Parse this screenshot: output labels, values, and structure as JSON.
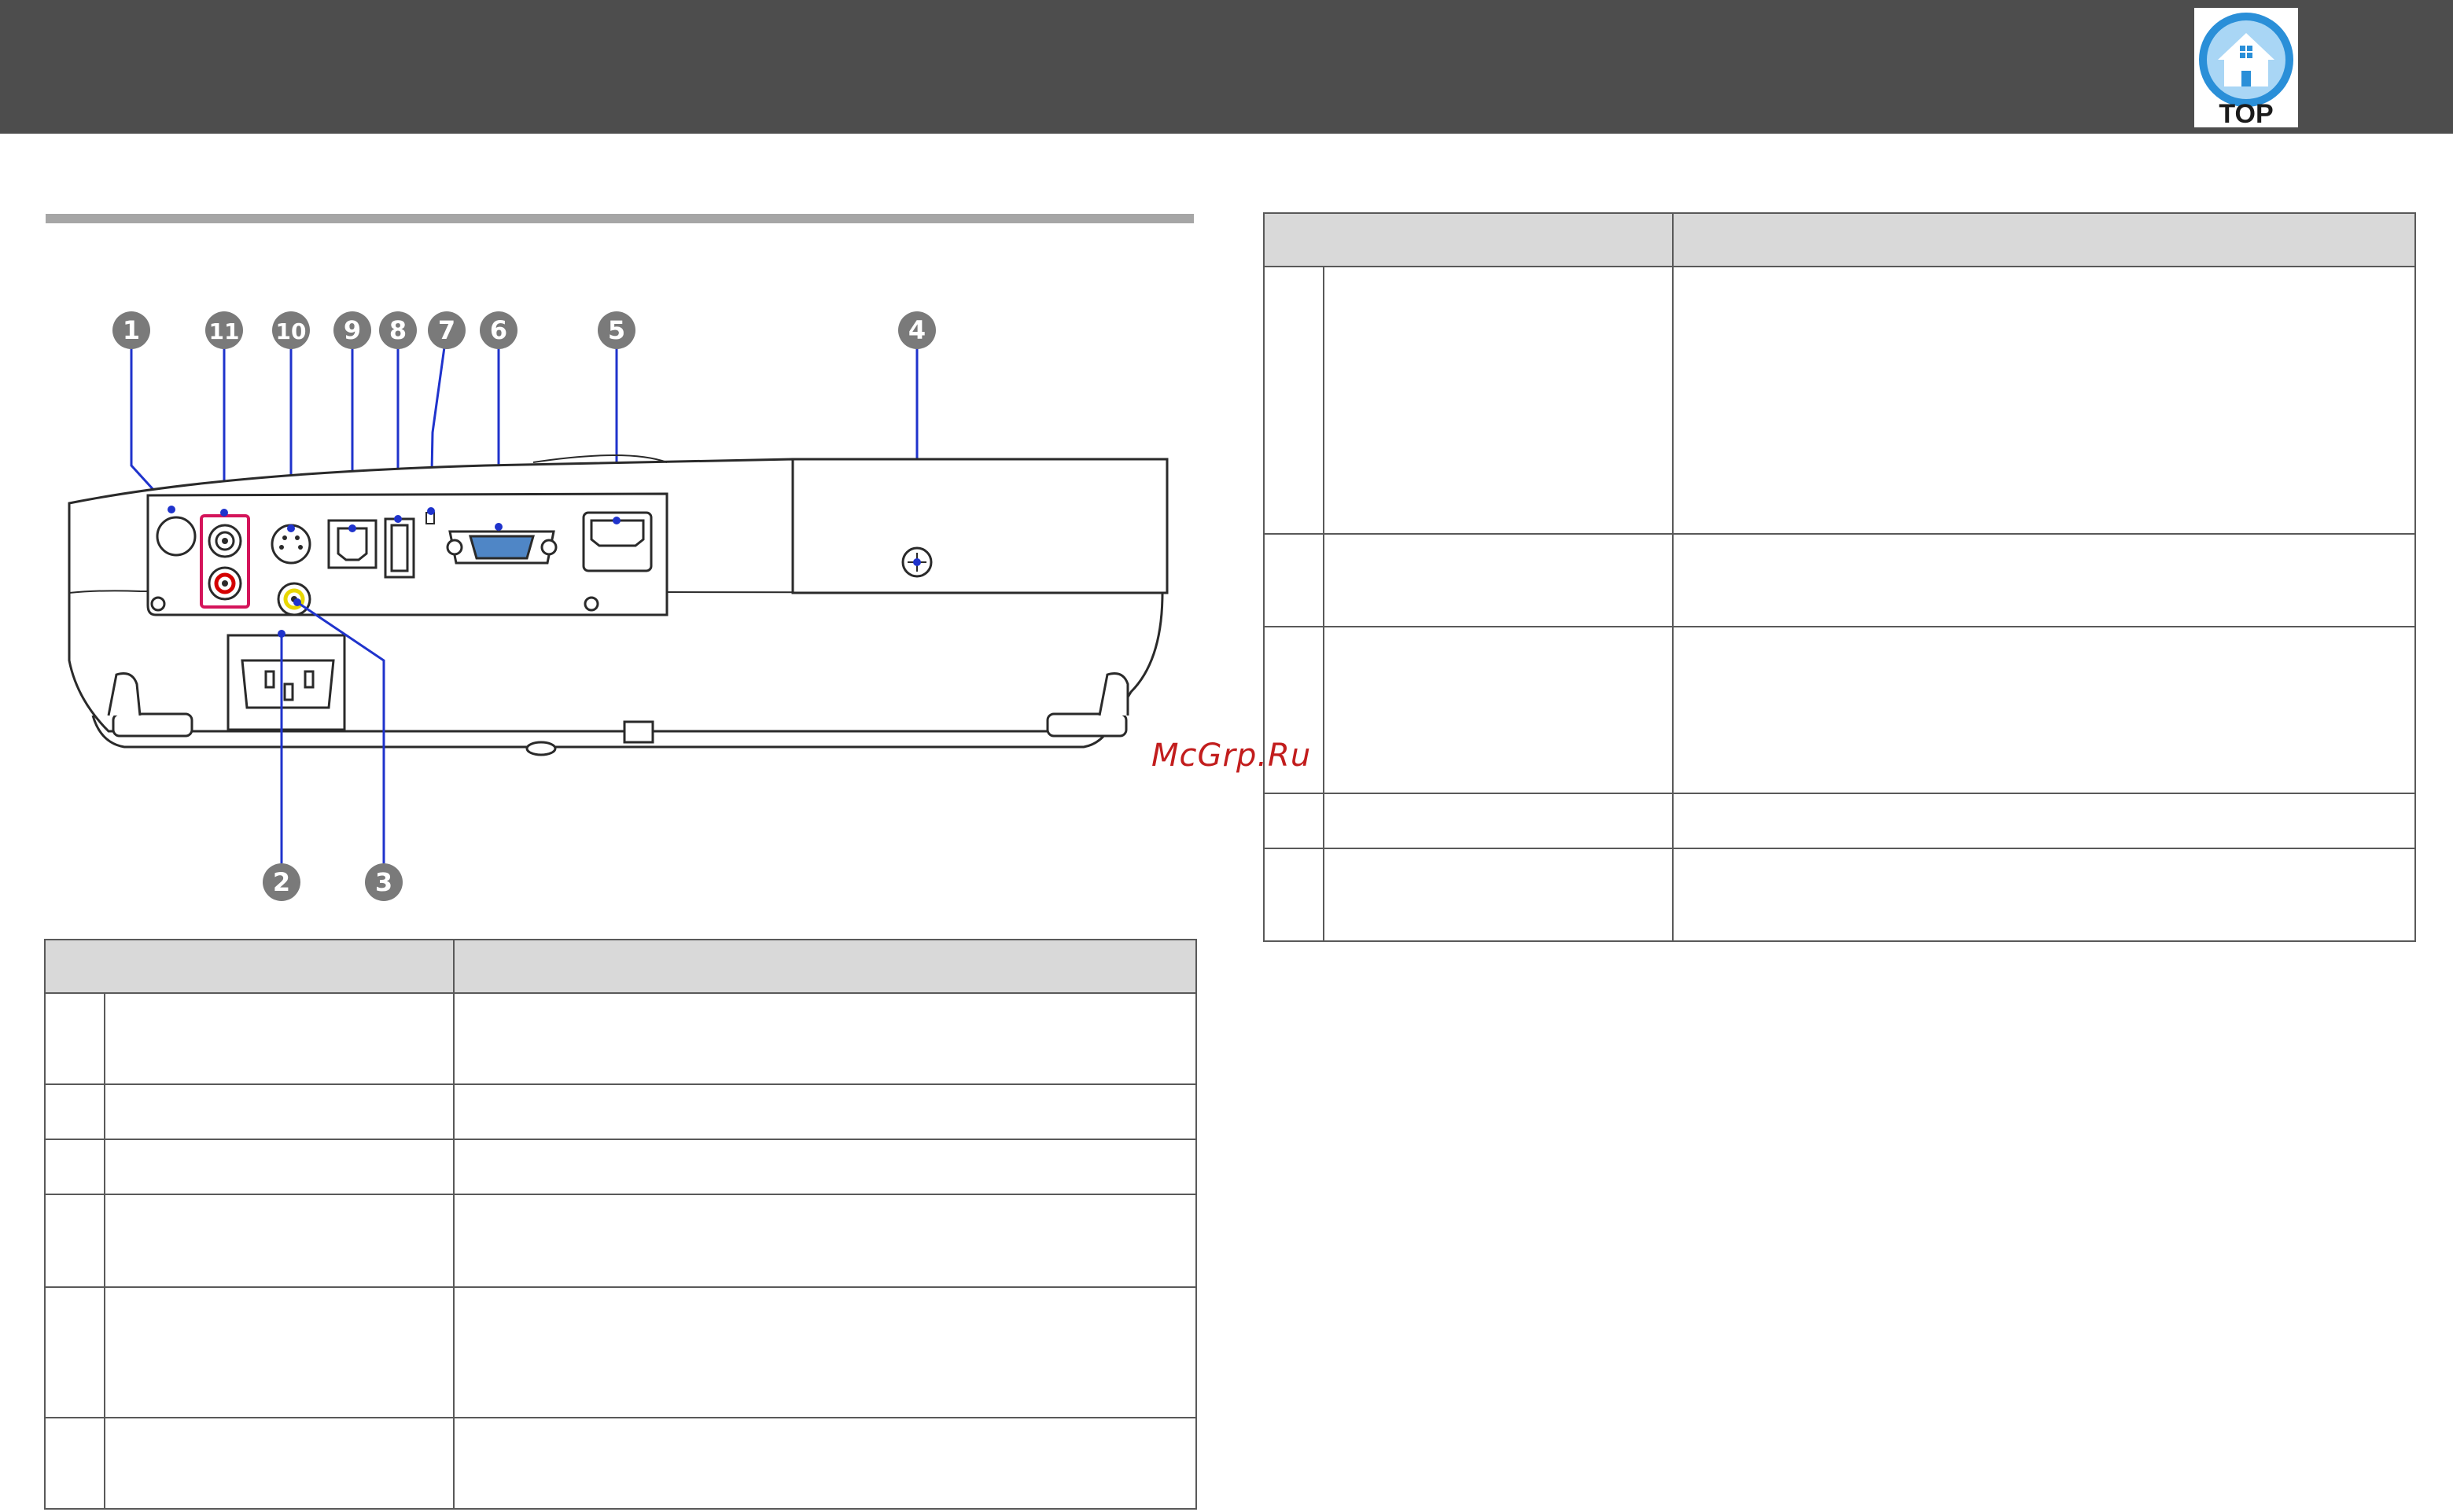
{
  "header": {
    "top_button_label": "TOP",
    "top_button_icon": "home-icon"
  },
  "diagram": {
    "callouts": [
      "1",
      "11",
      "10",
      "9",
      "8",
      "7",
      "6",
      "5",
      "4",
      "2",
      "3"
    ],
    "colors": {
      "callout_fill": "#7a7a7a",
      "leader_line": "#1f33cc",
      "audio_highlight": "#d4145a",
      "audio_red": "#d40000",
      "video_yellow": "#e8d700",
      "vga_blue": "#4f86c6"
    }
  },
  "watermark": "McGrp.Ru",
  "tables": {
    "left": {
      "columns": [
        "",
        ""
      ],
      "row_count": 6
    },
    "right": {
      "columns": [
        "",
        ""
      ],
      "row_count": 5
    }
  }
}
